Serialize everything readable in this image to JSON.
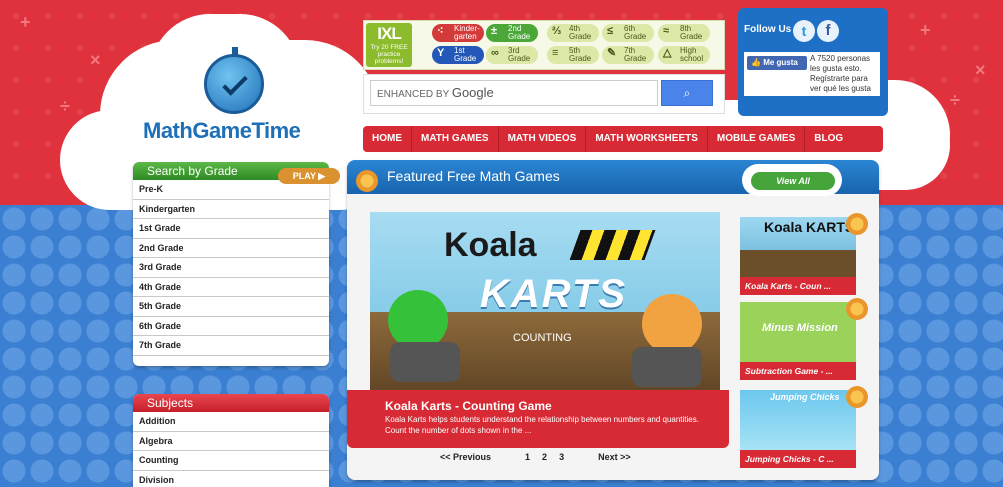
{
  "logo": {
    "name": "MathGameTime"
  },
  "ixl_ad": {
    "brand": "IXL",
    "tagline": "Try 20 FREE practice problems!",
    "grades": [
      {
        "label": "Kinder-garten",
        "icon": "dice-icon"
      },
      {
        "label": "2nd Grade",
        "icon": "plus-minus-icon"
      },
      {
        "label": "4th Grade",
        "icon": "fraction-icon"
      },
      {
        "label": "6th Grade",
        "icon": "less-equal-icon"
      },
      {
        "label": "8th Grade",
        "icon": "approx-icon"
      },
      {
        "label": "1st Grade",
        "icon": "cup-icon"
      },
      {
        "label": "3rd Grade",
        "icon": "infinity-icon"
      },
      {
        "label": "5th Grade",
        "icon": "stack-icon"
      },
      {
        "label": "7th Grade",
        "icon": "pencil-icon"
      },
      {
        "label": "High school",
        "icon": "triangle-icon"
      }
    ]
  },
  "search": {
    "placeholder": "ENHANCED BY",
    "brand": "Google",
    "button_icon": "search-icon"
  },
  "follow": {
    "title": "Follow Us",
    "like_label": "Me gusta",
    "like_text": "A 7520 personas les gusta esto. Regístrarte para ver qué les gusta"
  },
  "nav": [
    "HOME",
    "MATH GAMES",
    "MATH VIDEOS",
    "MATH WORKSHEETS",
    "MOBILE GAMES",
    "BLOG"
  ],
  "grades_panel": {
    "title": "Search by Grade",
    "items": [
      "Pre-K",
      "Kindergarten",
      "1st Grade",
      "2nd Grade",
      "3rd Grade",
      "4th Grade",
      "5th Grade",
      "6th Grade",
      "7th Grade"
    ]
  },
  "subjects_panel": {
    "title": "Subjects",
    "items": [
      "Addition",
      "Algebra",
      "Counting",
      "Division"
    ]
  },
  "featured": {
    "title": "Featured Free Math Games",
    "view_all": "View All",
    "main": {
      "art_title": "Koala",
      "art_karts": "KARTS",
      "art_sub": "COUNTING",
      "play": "PLAY",
      "title": "Koala Karts - Counting Game",
      "desc": "Koala Karts helps students understand the relationship between numbers and quantities. Count the number of dots shown in the ..."
    },
    "thumbs": [
      {
        "art": "Koala KARTS",
        "caption": "Koala Karts - Coun ..."
      },
      {
        "art": "Minus Mission",
        "caption": "Subtraction Game - ..."
      },
      {
        "art": "Jumping Chicks",
        "caption": "Jumping Chicks - C ..."
      }
    ],
    "pager": {
      "prev": "<< Previous",
      "pages": [
        "1",
        "2",
        "3"
      ],
      "next": "Next >>"
    }
  }
}
